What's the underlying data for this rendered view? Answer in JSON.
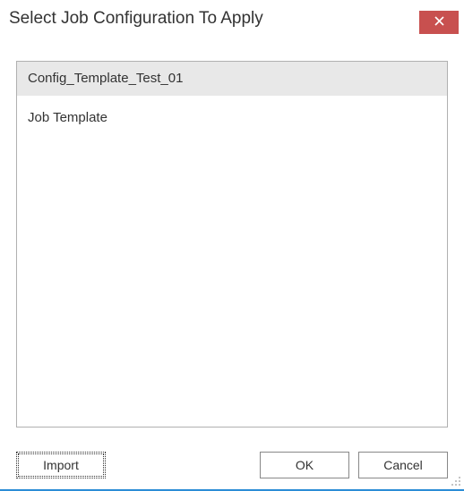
{
  "dialog": {
    "title": "Select Job Configuration To Apply"
  },
  "list": {
    "items": [
      {
        "label": "Config_Template_Test_01",
        "selected": true
      },
      {
        "label": "Job Template",
        "selected": false
      }
    ]
  },
  "buttons": {
    "import": "Import",
    "ok": "OK",
    "cancel": "Cancel"
  },
  "icons": {
    "close": "close-icon"
  }
}
